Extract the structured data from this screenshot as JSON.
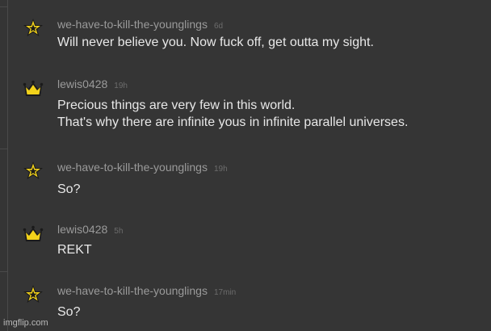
{
  "comments": [
    {
      "badge": "star-icon",
      "username": "we-have-to-kill-the-younglings",
      "time": "6d",
      "lines": [
        "Will never believe you. Now fuck off, get outta my sight."
      ]
    },
    {
      "badge": "crown-icon",
      "username": "lewis0428",
      "time": "19h",
      "lines": [
        "Precious things are very few in this world.",
        "That's why there are infinite yous in infinite parallel universes."
      ]
    },
    {
      "badge": "star-icon",
      "username": "we-have-to-kill-the-younglings",
      "time": "19h",
      "lines": [
        "So?"
      ]
    },
    {
      "badge": "crown-icon",
      "username": "lewis0428",
      "time": "5h",
      "lines": [
        "REKT"
      ]
    },
    {
      "badge": "star-icon",
      "username": "we-have-to-kill-the-younglings",
      "time": "17min",
      "lines": [
        "So?"
      ]
    }
  ],
  "watermark": "imgflip.com",
  "colors": {
    "background": "#353535",
    "username": "#9a9a9a",
    "timestamp": "#6c6c6c",
    "body_text": "#e8e8e8",
    "badge_gold": "#f2d21b"
  }
}
